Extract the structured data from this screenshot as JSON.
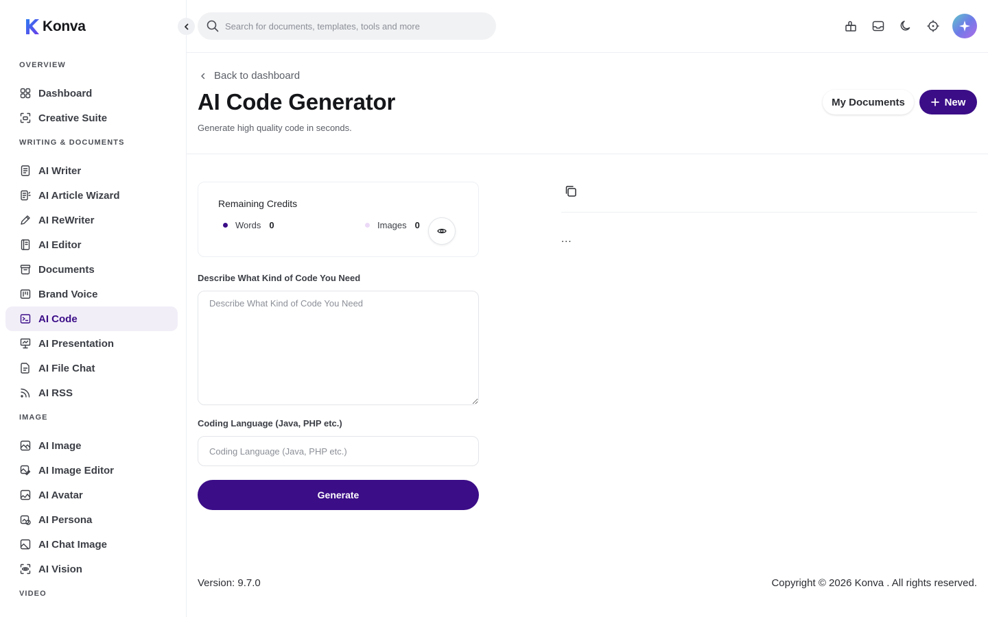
{
  "app": {
    "brand": "Konva"
  },
  "search": {
    "placeholder": "Search for documents, templates, tools and more"
  },
  "header_icons": [
    "gift-icon",
    "inbox-icon",
    "moon-icon",
    "crosshair-icon",
    "sparkle-avatar-icon"
  ],
  "sidebar": {
    "sections": [
      {
        "title": "OVERVIEW",
        "items": [
          {
            "label": "Dashboard",
            "icon": "grid-icon"
          },
          {
            "label": "Creative Suite",
            "icon": "creative-suite-icon"
          }
        ]
      },
      {
        "title": "WRITING & DOCUMENTS",
        "items": [
          {
            "label": "AI Writer",
            "icon": "document-icon"
          },
          {
            "label": "AI Article Wizard",
            "icon": "article-icon"
          },
          {
            "label": "AI ReWriter",
            "icon": "pen-icon"
          },
          {
            "label": "AI Editor",
            "icon": "editor-icon"
          },
          {
            "label": "Documents",
            "icon": "archive-icon"
          },
          {
            "label": "Brand Voice",
            "icon": "brand-icon"
          },
          {
            "label": "AI Code",
            "icon": "terminal-icon",
            "active": true
          },
          {
            "label": "AI Presentation",
            "icon": "presentation-icon"
          },
          {
            "label": "AI File Chat",
            "icon": "file-chat-icon"
          },
          {
            "label": "AI RSS",
            "icon": "rss-icon"
          }
        ]
      },
      {
        "title": "IMAGE",
        "items": [
          {
            "label": "AI Image",
            "icon": "image-icon"
          },
          {
            "label": "AI Image Editor",
            "icon": "image-editor-icon"
          },
          {
            "label": "AI Avatar",
            "icon": "avatar-image-icon"
          },
          {
            "label": "AI Persona",
            "icon": "persona-icon"
          },
          {
            "label": "AI Chat Image",
            "icon": "chat-image-icon"
          },
          {
            "label": "AI Vision",
            "icon": "vision-icon"
          }
        ]
      },
      {
        "title": "VIDEO",
        "items": []
      }
    ]
  },
  "page": {
    "back_label": "Back to dashboard",
    "title": "AI Code Generator",
    "subtitle": "Generate high quality code in seconds.",
    "my_documents_label": "My Documents",
    "new_label": "New"
  },
  "credits": {
    "title": "Remaining Credits",
    "words_label": "Words",
    "words_value": "0",
    "images_label": "Images",
    "images_value": "0",
    "words_color": "#3b0d87",
    "images_color": "#ecd9f7"
  },
  "form": {
    "description_label": "Describe What Kind of Code You Need",
    "description_placeholder": "Describe What Kind of Code You Need",
    "language_label": "Coding Language (Java, PHP etc.)",
    "language_placeholder": "Coding Language (Java, PHP etc.)",
    "generate_label": "Generate"
  },
  "output": {
    "text": "..."
  },
  "footer": {
    "version": "Version: 9.7.0",
    "copyright": "Copyright © 2026 Konva . All rights reserved."
  },
  "colors": {
    "accent": "#3b0d87",
    "active_bg": "#f2eef8"
  }
}
